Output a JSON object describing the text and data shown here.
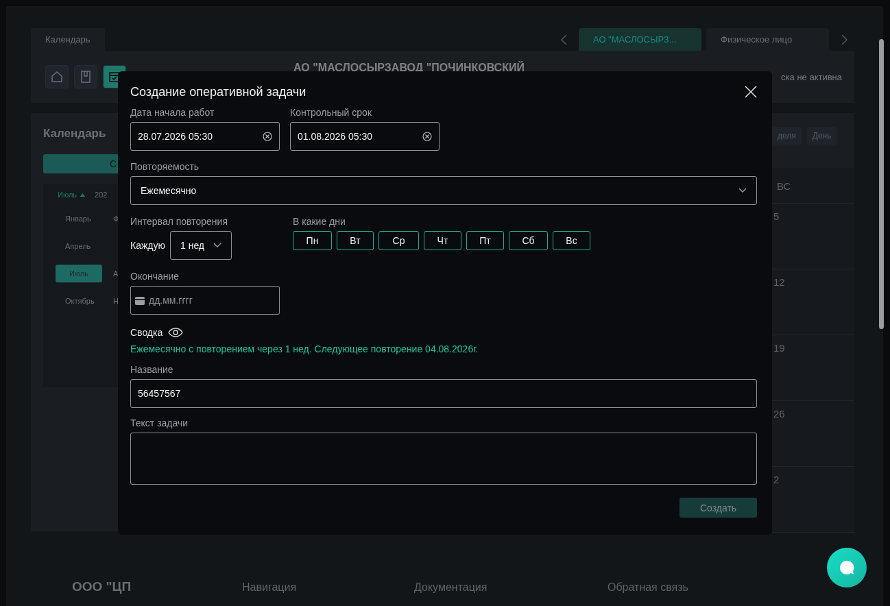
{
  "top_tabs": [
    {
      "label": "Календарь",
      "selected": false
    }
  ],
  "entity_tabs": [
    {
      "label": "АО \"МАСЛОСЫРЗ...",
      "selected": true
    },
    {
      "label": "Физическое лицо",
      "selected": false
    }
  ],
  "header": {
    "toolbar": [
      {
        "kind": "home",
        "selected": false
      },
      {
        "kind": "document",
        "selected": false
      },
      {
        "kind": "calendar",
        "selected": true
      }
    ],
    "company": "АО \"МАСЛОСЫРЗАВОД \"ПОЧИНКОВСКИЙ",
    "status": "ска не активна"
  },
  "calendar": {
    "title": "Календарь",
    "create_button": "С",
    "month": "Июль",
    "year": "202",
    "month_rows": [
      [
        {
          "label": "Январь",
          "selected": false
        },
        {
          "label": "Ф",
          "selected": false
        }
      ],
      [
        {
          "label": "Апрель",
          "selected": false
        }
      ],
      [
        {
          "label": "Июль",
          "selected": true
        },
        {
          "label": "А",
          "selected": false
        }
      ],
      [
        {
          "label": "Октябрь",
          "selected": false
        },
        {
          "label": "Н",
          "selected": false
        }
      ]
    ],
    "views": [
      {
        "label": "деля",
        "selected": false
      },
      {
        "label": "День",
        "selected": false
      }
    ],
    "weekday": "ВС",
    "dates": [
      "5",
      "12",
      "19",
      "26",
      "2"
    ]
  },
  "footer": {
    "company": "ООО \"ЦП",
    "columns": [
      "Навигация",
      "Документация",
      "Обратная связь"
    ]
  },
  "modal": {
    "title": "Создание оперативной задачи",
    "start": {
      "label": "Дата начала работ",
      "value": "28.07.2026 05:30"
    },
    "deadline": {
      "label": "Контрольный срок",
      "value": "01.08.2026 05:30"
    },
    "recurrence": {
      "label": "Повторяемость",
      "value": "Ежемесячно"
    },
    "interval": {
      "label": "Интервал повторения",
      "prefix": "Каждую",
      "value": "1 нед"
    },
    "days": {
      "label": "В какие дни",
      "items": [
        {
          "label": "Пн",
          "selected": false
        },
        {
          "label": "Вт",
          "selected": false
        },
        {
          "label": "Ср",
          "selected": false
        },
        {
          "label": "Чт",
          "selected": false
        },
        {
          "label": "Пт",
          "selected": false
        },
        {
          "label": "Сб",
          "selected": false
        },
        {
          "label": "Вс",
          "selected": false
        }
      ]
    },
    "end": {
      "label": "Окончание",
      "placeholder": "дд.мм.гггг"
    },
    "summary": {
      "label": "Сводка",
      "text": "Ежемесячно с повторением через 1 нед. Следующее повторение 04.08.2026г."
    },
    "name": {
      "label": "Название",
      "value": "56457567"
    },
    "task_text": {
      "label": "Текст задачи"
    },
    "submit": {
      "label": "Создать",
      "disabled": true
    }
  }
}
